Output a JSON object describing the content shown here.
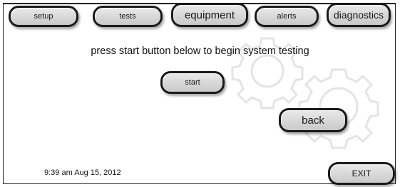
{
  "nav": {
    "setup_label": "setup",
    "tests_label": "tests",
    "equipment_label": "equipment",
    "alerts_label": "alerts",
    "diagnostics_label": "diagnostics"
  },
  "main": {
    "instruction": "press start button below to begin system testing",
    "start_label": "start",
    "back_label": "back"
  },
  "footer": {
    "timestamp": "9:39 am Aug 15, 2012",
    "exit_label": "EXIT"
  },
  "colors": {
    "button_fill": "#d8d8d8",
    "button_border": "#1a1a1a",
    "background": "#ffffff",
    "watermark": "#e6e6e6"
  },
  "icons": {
    "watermark": "gears-watermark-icon"
  }
}
